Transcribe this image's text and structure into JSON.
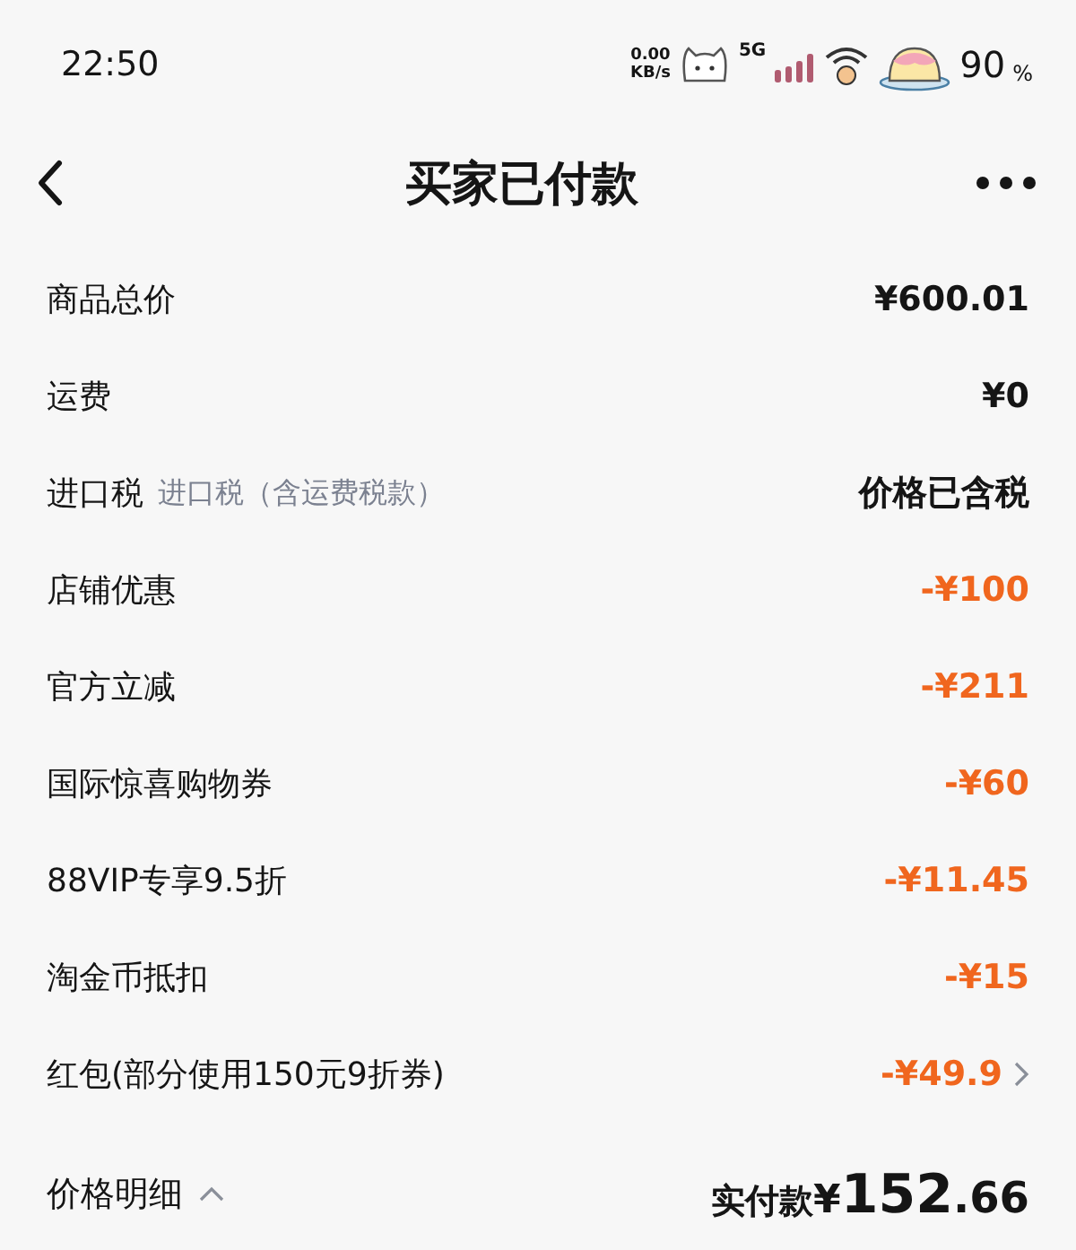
{
  "status_bar": {
    "time": "22:50",
    "speed_value": "0.00",
    "speed_unit": "KB/s",
    "network": "5G",
    "battery": "90",
    "battery_unit": "%"
  },
  "header": {
    "title": "买家已付款"
  },
  "rows": [
    {
      "label": "商品总价",
      "value": "¥600.01",
      "kind": "plain"
    },
    {
      "label": "运费",
      "value": "¥0",
      "kind": "plain"
    },
    {
      "label": "进口税",
      "note": "进口税（含运费税款）",
      "value": "价格已含税",
      "kind": "plain"
    },
    {
      "label": "店铺优惠",
      "value": "-¥100",
      "kind": "discount"
    },
    {
      "label": "官方立减",
      "value": "-¥211",
      "kind": "discount"
    },
    {
      "label": "国际惊喜购物券",
      "value": "-¥60",
      "kind": "discount"
    },
    {
      "label": "88VIP专享9.5折",
      "value": "-¥11.45",
      "kind": "discount"
    },
    {
      "label": "淘金币抵扣",
      "value": "-¥15",
      "kind": "discount"
    },
    {
      "label": "红包(部分使用150元9折券)",
      "value": "-¥49.9",
      "kind": "discount",
      "expandable": true
    }
  ],
  "footer": {
    "details_label": "价格明细",
    "expanded": true,
    "total_label": "实付款",
    "currency": "¥",
    "total_int": "152",
    "total_dec": ".66"
  }
}
